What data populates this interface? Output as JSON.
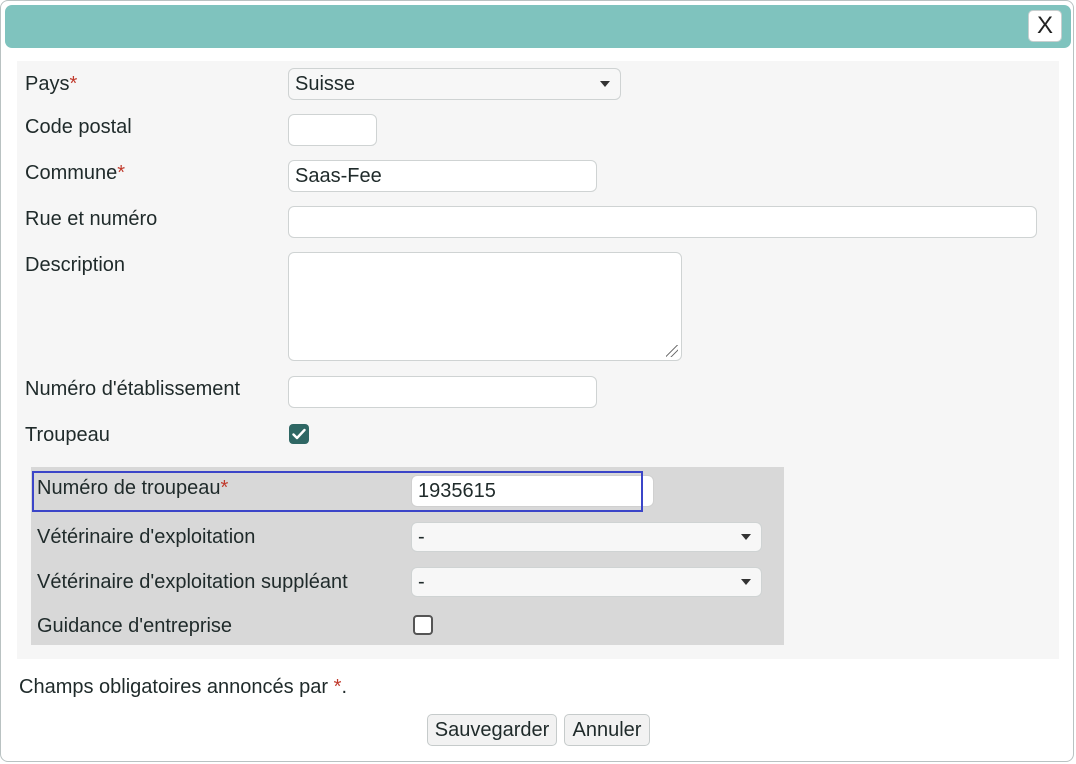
{
  "dialog": {
    "close_label": "X"
  },
  "form": {
    "required_marker": "*",
    "country": {
      "label": "Pays",
      "value": "Suisse"
    },
    "postal_code": {
      "label": "Code postal",
      "value": ""
    },
    "municipality": {
      "label": "Commune",
      "value": "Saas-Fee"
    },
    "street": {
      "label": "Rue et numéro",
      "value": ""
    },
    "description": {
      "label": "Description",
      "value": ""
    },
    "establishment_number": {
      "label": "Numéro d'établissement",
      "value": ""
    },
    "herd": {
      "label": "Troupeau",
      "checked": true
    }
  },
  "herd_section": {
    "herd_number": {
      "label": "Numéro de troupeau",
      "value": "1935615"
    },
    "vet": {
      "label": "Vétérinaire d'exploitation",
      "value": "-"
    },
    "vet_substitute": {
      "label": "Vétérinaire d'exploitation suppléant",
      "value": "-"
    },
    "business_guidance": {
      "label": "Guidance d'entreprise",
      "checked": false
    }
  },
  "footer": {
    "note_prefix": "Champs obligatoires annoncés par ",
    "note_marker": "*",
    "note_suffix": ".",
    "save_label": "Sauvegarder",
    "cancel_label": "Annuler"
  },
  "colors": {
    "titlebar": "#7fc3be",
    "required": "#c0392b",
    "focus": "#3b45c8",
    "checkbox": "#2f6764"
  }
}
